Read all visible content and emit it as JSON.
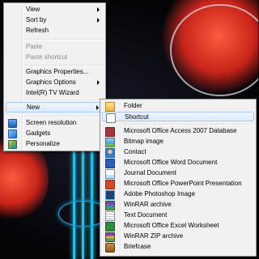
{
  "colors": {
    "menu_bg": "#f1f1f1",
    "highlight": "#dcebfc",
    "disabled": "#8b8b8b",
    "desktop_accent": "#19c4e6"
  },
  "context_menu": {
    "items": [
      {
        "label": "View",
        "has_submenu": true
      },
      {
        "label": "Sort by",
        "has_submenu": true
      },
      {
        "label": "Refresh"
      },
      {
        "label": "Paste",
        "disabled": true
      },
      {
        "label": "Paste shortcut",
        "disabled": true
      },
      {
        "label": "Graphics Properties..."
      },
      {
        "label": "Graphics Options",
        "has_submenu": true
      },
      {
        "label": "Intel(R) TV Wizard"
      },
      {
        "label": "New",
        "has_submenu": true,
        "highlighted": true
      },
      {
        "label": "Screen resolution",
        "icon": "screen-resolution-icon"
      },
      {
        "label": "Gadgets",
        "icon": "gadgets-icon"
      },
      {
        "label": "Personalize",
        "icon": "personalize-icon"
      }
    ]
  },
  "new_submenu": {
    "items": [
      {
        "label": "Folder",
        "icon": "folder-icon"
      },
      {
        "label": "Shortcut",
        "icon": "shortcut-icon",
        "highlighted": true
      },
      {
        "label": "Microsoft Office Access 2007 Database",
        "icon": "access-icon"
      },
      {
        "label": "Bitmap image",
        "icon": "bitmap-icon"
      },
      {
        "label": "Contact",
        "icon": "contact-icon"
      },
      {
        "label": "Microsoft Office Word Document",
        "icon": "word-icon"
      },
      {
        "label": "Journal Document",
        "icon": "journal-icon"
      },
      {
        "label": "Microsoft Office PowerPoint Presentation",
        "icon": "powerpoint-icon"
      },
      {
        "label": "Adobe Photoshop Image",
        "icon": "photoshop-icon"
      },
      {
        "label": "WinRAR archive",
        "icon": "winrar-icon"
      },
      {
        "label": "Text Document",
        "icon": "text-document-icon"
      },
      {
        "label": "Microsoft Office Excel Worksheet",
        "icon": "excel-icon"
      },
      {
        "label": "WinRAR ZIP archive",
        "icon": "winrar-zip-icon"
      },
      {
        "label": "Briefcase",
        "icon": "briefcase-icon"
      }
    ]
  }
}
